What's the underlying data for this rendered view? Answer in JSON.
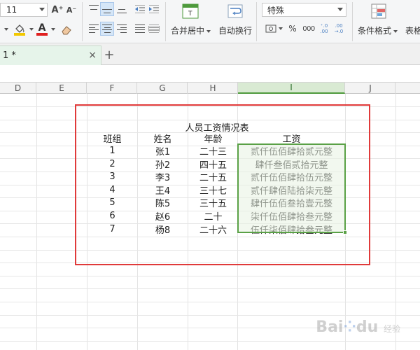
{
  "ribbon": {
    "font_size": "11",
    "grow_font_label": "A⁺",
    "shrink_font_label": "A⁻",
    "merge_center_label": "合并居中",
    "wrap_text_label": "自动换行",
    "number_format": "特殊",
    "percent_label": "%",
    "thousands_label": "000",
    "increase_decimal_label": "⁺.0\n.00",
    "decrease_decimal_label": ".00\n→.0",
    "cond_format_label": "条件格式",
    "table_style_label": "表格",
    "colors": {
      "fill": "#f2c800",
      "font": "#e02020"
    }
  },
  "tabs": {
    "doc_tab_label": "1 *",
    "close_label": "×",
    "add_label": "+"
  },
  "sheet": {
    "columns": [
      "D",
      "E",
      "F",
      "G",
      "H",
      "I",
      "J"
    ],
    "selected_column": "I",
    "title": "人员工资情况表",
    "headers": [
      "班组",
      "姓名",
      "年龄",
      "工资"
    ],
    "rows": [
      [
        "1",
        "张1",
        "二十三",
        "贰仟伍佰肆拾贰元整"
      ],
      [
        "2",
        "孙2",
        "四十五",
        "肆仟叁佰贰拾元整"
      ],
      [
        "3",
        "李3",
        "二十五",
        "贰仟伍佰肆拾伍元整"
      ],
      [
        "4",
        "王4",
        "三十七",
        "贰仟肆佰陆拾柒元整"
      ],
      [
        "5",
        "陈5",
        "三十五",
        "肆仟伍佰叁拾壹元整"
      ],
      [
        "6",
        "赵6",
        "二十",
        "柒仟伍佰肆拾叁元整"
      ],
      [
        "7",
        "杨8",
        "二十六",
        "伍仟柒佰肆拾叁元整"
      ]
    ],
    "selection_color": "#5aa146",
    "highlight_box_color": "#e03a3a"
  },
  "watermark": {
    "brand": "Bai",
    "mark": "du",
    "suffix": "经验"
  }
}
